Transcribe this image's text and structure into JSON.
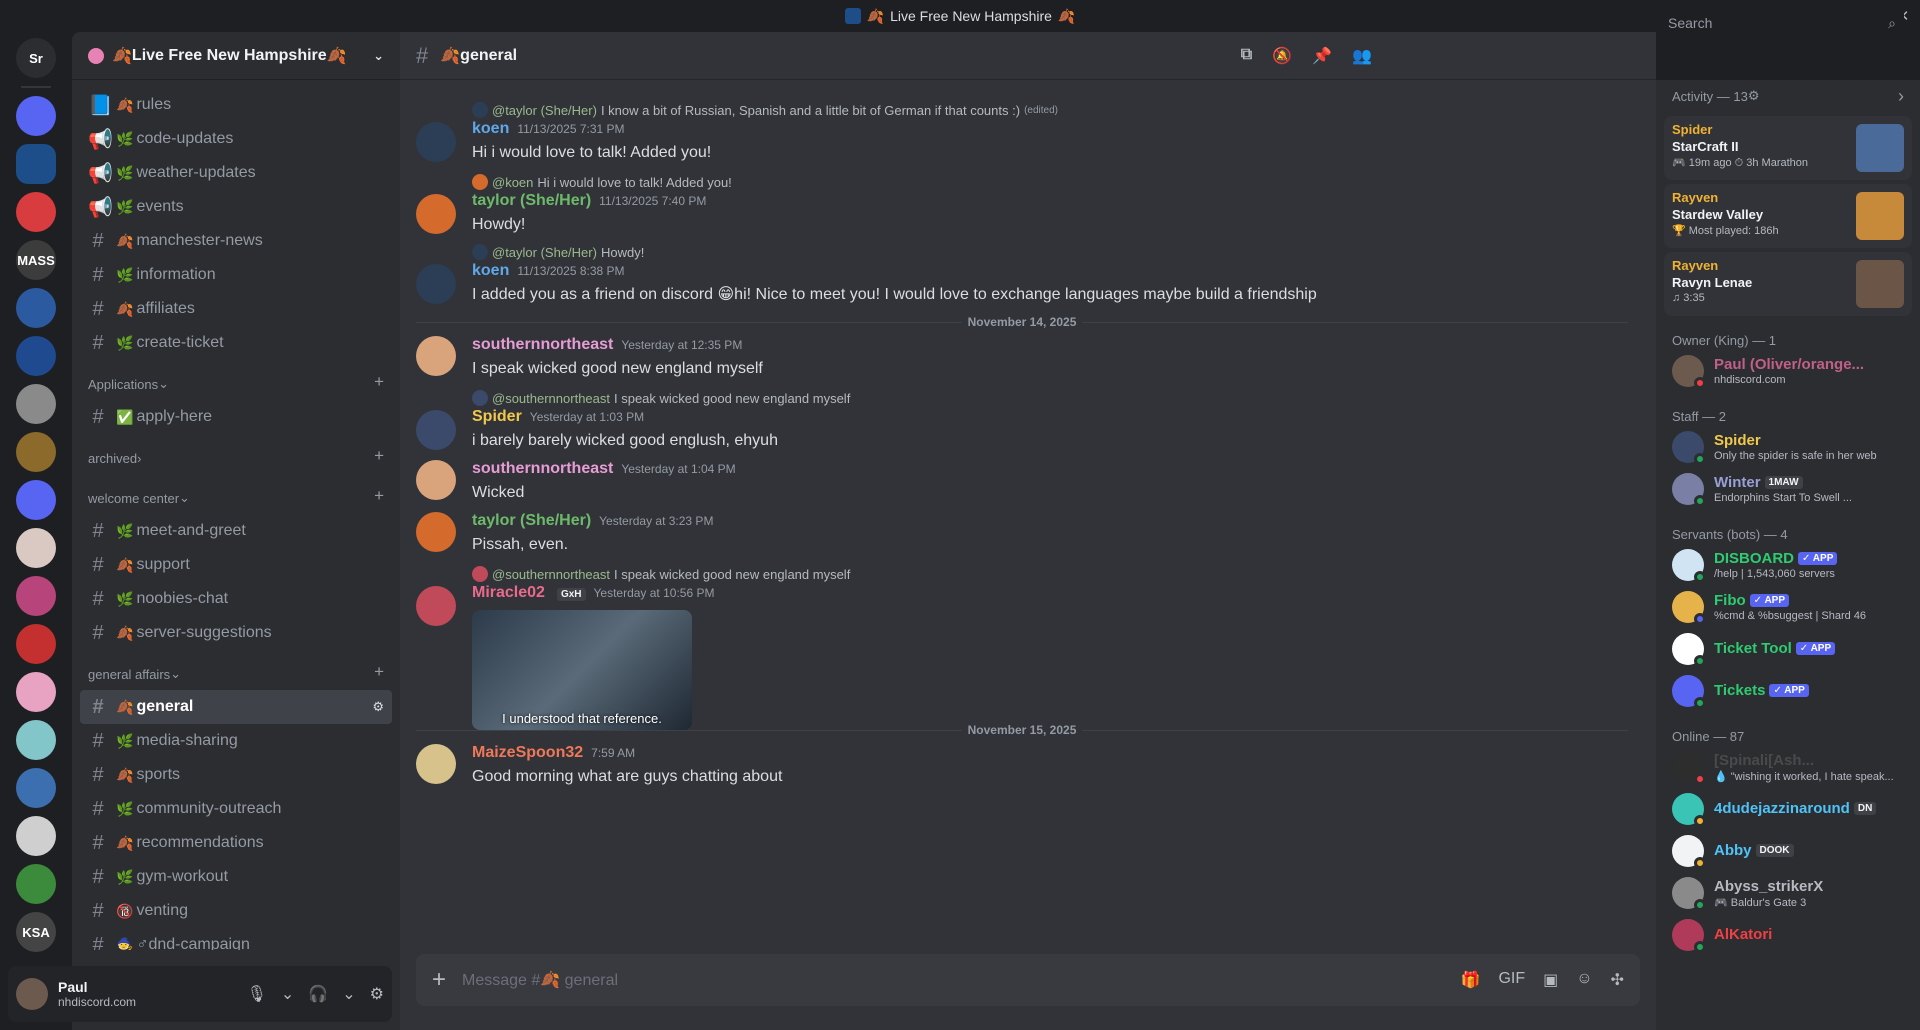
{
  "window": {
    "title": "Live Free New Hampshire"
  },
  "servers": [
    {
      "name": "Sr",
      "label": "Sr",
      "color": "#2b2d31"
    },
    {
      "name": "folder-1",
      "label": "",
      "color": "#5865f2"
    },
    {
      "name": "live-free-nh",
      "label": "",
      "color": "#1d4e89"
    },
    {
      "name": "red-circle",
      "label": "",
      "color": "#d83c3e"
    },
    {
      "name": "mass-hangouts",
      "label": "MASS",
      "color": "#3c3c3c"
    },
    {
      "name": "maine",
      "label": "",
      "color": "#2c5aa0"
    },
    {
      "name": "nh-seal",
      "label": "",
      "color": "#1f4a8f"
    },
    {
      "name": "flag-server",
      "label": "",
      "color": "#8a8a8a"
    },
    {
      "name": "civ-server",
      "label": "",
      "color": "#8b6a2b"
    },
    {
      "name": "folder-2",
      "label": "",
      "color": "#5865f2"
    },
    {
      "name": "anime-1",
      "label": "",
      "color": "#d9c9c2"
    },
    {
      "name": "rainbow",
      "label": "",
      "color": "#b7457c"
    },
    {
      "name": "half-life",
      "label": "",
      "color": "#c3302f"
    },
    {
      "name": "anime-2",
      "label": "",
      "color": "#e8a3c3"
    },
    {
      "name": "anime-3",
      "label": "",
      "color": "#83c6c9"
    },
    {
      "name": "anime-4",
      "label": "",
      "color": "#3c6fb0"
    },
    {
      "name": "ninja",
      "label": "",
      "color": "#cfcfcf"
    },
    {
      "name": "minecraft",
      "label": "",
      "color": "#3c8b3c"
    },
    {
      "name": "ksa",
      "label": "KSA",
      "color": "#444"
    }
  ],
  "guild": {
    "name": "Live Free New Hampshire"
  },
  "channels_top": [
    {
      "type": "rules",
      "icon": "📘",
      "emo": "🍂",
      "label": "rules"
    },
    {
      "type": "announce",
      "icon": "📢",
      "emo": "🌿",
      "label": "code-updates"
    },
    {
      "type": "announce",
      "icon": "📢",
      "emo": "🌿",
      "label": "weather-updates"
    },
    {
      "type": "announce",
      "icon": "📢",
      "emo": "🌿",
      "label": "events"
    },
    {
      "type": "text",
      "icon": "#",
      "emo": "🍂",
      "label": "manchester-news"
    },
    {
      "type": "text",
      "icon": "#",
      "emo": "🌿",
      "label": "information"
    },
    {
      "type": "text",
      "icon": "#",
      "emo": "🍂",
      "label": "affiliates"
    },
    {
      "type": "text",
      "icon": "#",
      "emo": "🌿",
      "label": "create-ticket"
    }
  ],
  "cat_applications": {
    "label": "Applications"
  },
  "channels_apps": [
    {
      "icon": "#",
      "emo": "✅",
      "label": "apply-here"
    }
  ],
  "cat_archived": {
    "label": "archived"
  },
  "cat_welcome": {
    "label": "welcome center"
  },
  "channels_welcome": [
    {
      "icon": "#",
      "emo": "🌿",
      "label": "meet-and-greet"
    },
    {
      "icon": "#",
      "emo": "🍂",
      "label": "support"
    },
    {
      "icon": "#",
      "emo": "🌿",
      "label": "noobies-chat"
    },
    {
      "icon": "#",
      "emo": "🍂",
      "label": "server-suggestions"
    }
  ],
  "cat_general": {
    "label": "general affairs"
  },
  "channels_general": [
    {
      "icon": "#",
      "emo": "🍂",
      "label": "general",
      "selected": true
    },
    {
      "icon": "#",
      "emo": "🌿",
      "label": "media-sharing"
    },
    {
      "icon": "#",
      "emo": "🍂",
      "label": "sports"
    },
    {
      "icon": "#",
      "emo": "🌿",
      "label": "community-outreach"
    },
    {
      "icon": "#",
      "emo": "🍂",
      "label": "recommendations"
    },
    {
      "icon": "#",
      "emo": "🌿",
      "label": "gym-workout"
    },
    {
      "icon": "#",
      "emo": "🔞",
      "label": "venting"
    },
    {
      "icon": "#",
      "emo": "🧙",
      "label": "♂dnd-campaign"
    }
  ],
  "user": {
    "name": "Paul",
    "status": "nhdiscord.com"
  },
  "channel": {
    "name": "general"
  },
  "search": {
    "placeholder": "Search"
  },
  "messages": [
    {
      "reply_name": "@taylor (She/Her)",
      "reply_text": "I know a bit of Russian, Spanish  and a little bit of German if that counts :)",
      "reply_edited": "(edited)",
      "name": "koen",
      "name_color": "#5fa8e9",
      "time": "11/13/2025 7:31 PM",
      "text": "Hi i would love to talk! Added you!",
      "av": "#2c3e55"
    },
    {
      "reply_name": "@koen",
      "reply_text": "Hi i would love to talk! Added you!",
      "name": "taylor (She/Her)",
      "name_color": "#6dbb6a",
      "time": "11/13/2025 7:40 PM",
      "text": "Howdy!",
      "av": "#d46a2c"
    },
    {
      "reply_name": "@taylor (She/Her)",
      "reply_text": "Howdy!",
      "name": "koen",
      "name_color": "#5fa8e9",
      "time": "11/13/2025 8:38 PM",
      "text": "I added you as a friend on discord 😁hi! Nice to meet you! I would love to exchange languages maybe build a friendship",
      "av": "#2c3e55"
    },
    {
      "name": "southernnortheast",
      "name_color": "#e79dd4",
      "time": "Yesterday at 12:35 PM",
      "text": "I speak wicked good new england myself",
      "av": "#d9a37b"
    },
    {
      "reply_name": "@southernnortheast",
      "reply_text": "I speak wicked good new england myself",
      "name": "Spider",
      "name_color": "#f0c84b",
      "time": "Yesterday at 1:03 PM",
      "text": "i barely barely wicked good englush, ehyuh",
      "av": "#3b4a6b"
    },
    {
      "name": "southernnortheast",
      "name_color": "#e79dd4",
      "time": "Yesterday at 1:04 PM",
      "text": "Wicked",
      "av": "#d9a37b"
    },
    {
      "name": "taylor (She/Her)",
      "name_color": "#6dbb6a",
      "time": "Yesterday at 3:23 PM",
      "text": "Pissah, even.",
      "av": "#d46a2c"
    },
    {
      "reply_name": "@southernnortheast",
      "reply_text": "I speak wicked good new england myself",
      "name": "Miracle02",
      "name_color": "#ea6a8c",
      "tag": "GxH",
      "time": "Yesterday at 10:56 PM",
      "gif_caption": "I understood that reference.",
      "av": "#c04a5a"
    },
    {
      "name": "MaizeSpoon32",
      "name_color": "#f0785a",
      "time": "7:59 AM",
      "text": "Good morning what are guys chatting about",
      "av": "#d6c28a"
    }
  ],
  "dividers": [
    "November 14, 2025",
    "November 15, 2025"
  ],
  "composer": {
    "placeholder": "Message #🍂 general"
  },
  "activity": {
    "header": "Activity — 13",
    "cards": [
      {
        "user": "Spider",
        "game": "StarCraft II",
        "detail": "🎮 19m ago  ⏱ 3h Marathon",
        "art": "#4a6a9a"
      },
      {
        "user": "Rayven",
        "game": "Stardew Valley",
        "detail": "🏆 Most played: 186h",
        "art": "#c7893a"
      },
      {
        "user": "Rayven",
        "game": "Ravyn Lenae",
        "detail": "♫ 3:35",
        "art": "#6b5547"
      }
    ]
  },
  "member_sections": [
    {
      "title": "Owner (King) — 1",
      "members": [
        {
          "name": "Paul (Oliver/orange...",
          "color": "#c0608a",
          "sub": "nhdiscord.com",
          "av": "#6d5a4f",
          "status": "#f23f43"
        }
      ]
    },
    {
      "title": "Staff — 2",
      "members": [
        {
          "name": "Spider",
          "color": "#f0c84b",
          "sub": "Only the spider is safe in her web",
          "av": "#3b4a6b",
          "status": "#23a55a"
        },
        {
          "name": "Winter",
          "color": "#9a9fd6",
          "sub": "Endorphins Start To Swell ...",
          "av": "#7a7fa6",
          "status": "#23a55a",
          "tag": "1MAW"
        }
      ]
    },
    {
      "title": "Servants (bots) — 4",
      "members": [
        {
          "name": "DISBOARD",
          "color": "#2ecc71",
          "sub": "/help | 1,543,060 servers",
          "av": "#d0e4f4",
          "status": "#23a55a",
          "badge": "✓ APP"
        },
        {
          "name": "Fibo",
          "color": "#2ecc71",
          "sub": "%cmd & %bsuggest | Shard 46",
          "av": "#e6b34a",
          "status": "#5865f2",
          "badge": "✓ APP"
        },
        {
          "name": "Ticket Tool",
          "color": "#2ecc71",
          "sub": "",
          "av": "#ffffff",
          "status": "#23a55a",
          "badge": "✓ APP"
        },
        {
          "name": "Tickets",
          "color": "#2ecc71",
          "sub": "",
          "av": "#5865f2",
          "status": "#23a55a",
          "badge": "✓ APP"
        }
      ]
    },
    {
      "title": "Online — 87",
      "members": [
        {
          "name": "[Spinali[Ash...",
          "color": "#4a4a4a",
          "sub": "💧 \"wishing it worked, I hate speak...",
          "av": "#2d2d2d",
          "status": "#f23f43"
        },
        {
          "name": "4dudejazzinaround",
          "color": "#4fc3f7",
          "sub": "",
          "av": "#39c4b6",
          "status": "#f0b232",
          "tag": "DN"
        },
        {
          "name": "Abby",
          "color": "#4fc3f7",
          "sub": "",
          "av": "#f2f3f5",
          "status": "#f0b232",
          "tag": "DOOK"
        },
        {
          "name": "Abyss_strikerX",
          "color": "#b5bac1",
          "sub": "🎮 Baldur's Gate 3",
          "av": "#8a8a8a",
          "status": "#23a55a"
        },
        {
          "name": "AlKatori",
          "color": "#f23f43",
          "sub": "",
          "av": "#b03a5a",
          "status": "#23a55a"
        }
      ]
    }
  ]
}
